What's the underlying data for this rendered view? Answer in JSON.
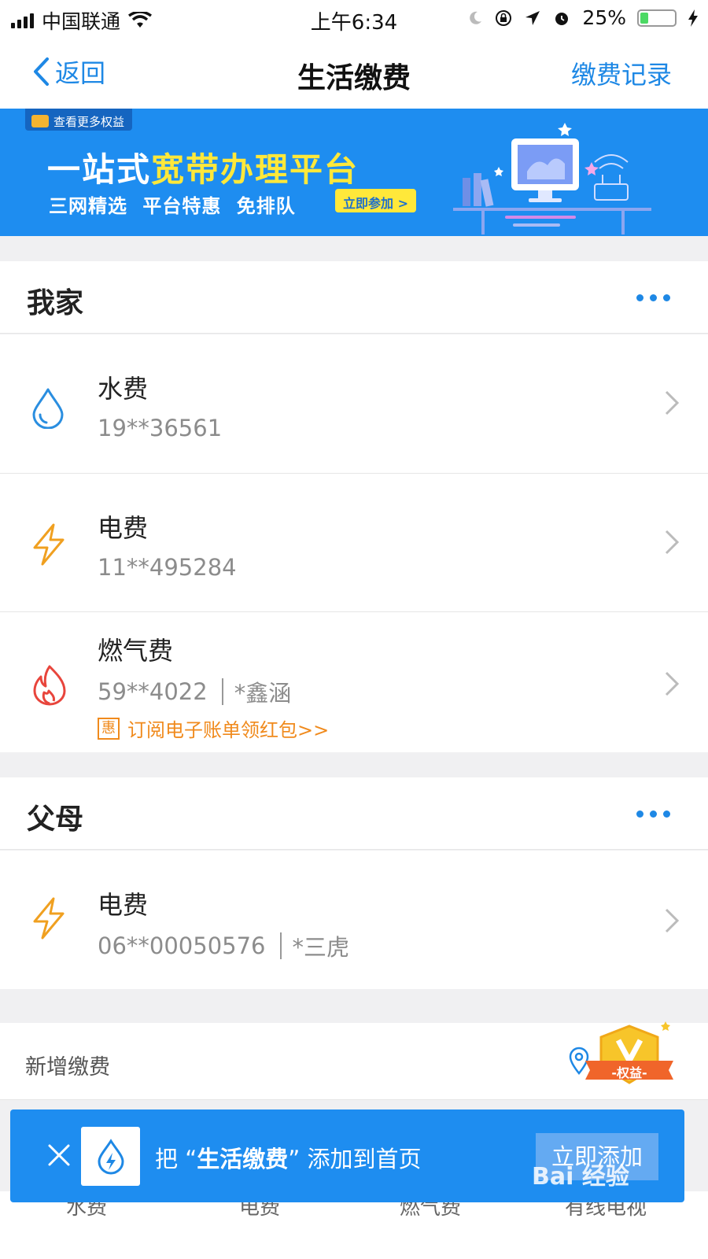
{
  "status_bar": {
    "carrier": "中国联通",
    "time": "上午6:34",
    "battery": "25%"
  },
  "nav": {
    "back_label": "返回",
    "title": "生活缴费",
    "right_label": "缴费记录"
  },
  "banner": {
    "badge": "查看更多权益",
    "title_plain": "一站式",
    "title_highlight": "宽带办理平台",
    "subtitle": "三网精选  平台特惠  免排队",
    "button": "立即参加 >"
  },
  "groups": [
    {
      "title": "我家",
      "items": [
        {
          "name": "水费",
          "account": "19**36561",
          "icon": "water-drop-icon"
        },
        {
          "name": "电费",
          "account": "11**495284",
          "icon": "lightning-icon"
        },
        {
          "name": "燃气费",
          "account": "59**4022",
          "holder": "*鑫涵",
          "promo_tag": "惠",
          "promo": "订阅电子账单领红包>>",
          "icon": "flame-icon"
        }
      ]
    },
    {
      "title": "父母",
      "items": [
        {
          "name": "电费",
          "account": "06**00050576",
          "holder": "*三虎",
          "icon": "lightning-icon"
        }
      ]
    }
  ],
  "add_new": {
    "label": "新增缴费"
  },
  "vip_badge": {
    "label": "-权益-"
  },
  "tabs": [
    "水费",
    "电费",
    "燃气费",
    "有线电视"
  ],
  "toast": {
    "prefix": "把 “",
    "highlight": "生活缴费",
    "suffix": "” 添加到首页",
    "button": "立即添加"
  },
  "watermark": "Bai 经验",
  "colors": {
    "accent": "#1e88e5",
    "banner_bg": "#1e8df0",
    "highlight_yellow": "#ffe83a",
    "promo_orange": "#f08a1c",
    "water_blue": "#2a8ee0",
    "electric_orange": "#f0a020",
    "gas_red": "#e8453c"
  }
}
